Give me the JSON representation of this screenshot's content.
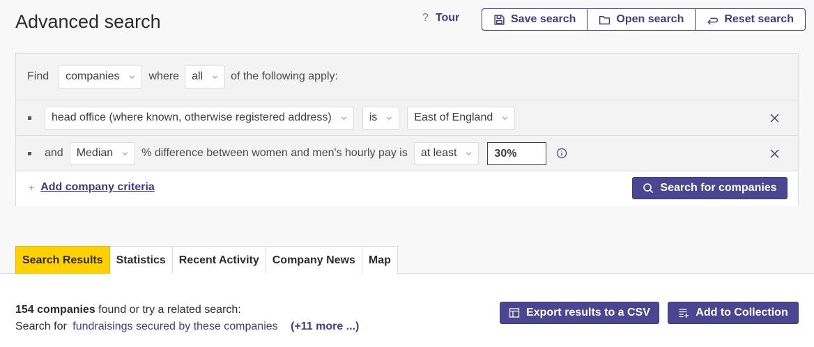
{
  "header": {
    "title": "Advanced search",
    "tour_icon": "?",
    "tour_label": "Tour",
    "save_label": "Save search",
    "open_label": "Open search",
    "reset_label": "Reset search"
  },
  "find_row": {
    "find": "Find",
    "entity": "companies",
    "where": "where",
    "quantifier": "all",
    "suffix": "of the following apply:"
  },
  "criteria": [
    {
      "field": "head office (where known, otherwise registered address)",
      "operator": "is",
      "value": "East of England"
    },
    {
      "conjunction": "and",
      "measure": "Median",
      "description": "% difference between women and men's hourly pay is",
      "operator": "at least",
      "value": "30%"
    }
  ],
  "add_criteria": {
    "plus": "+",
    "label": "Add company criteria"
  },
  "search_button": "Search for companies",
  "tabs": [
    "Search Results",
    "Statistics",
    "Recent Activity",
    "Company News",
    "Map"
  ],
  "results": {
    "count": "154 companies",
    "count_suffix": " found or try a related search:",
    "related_prefix": "Search for",
    "related_link": "fundraisings secured by these companies",
    "more": "(+11 more ...)",
    "export_label": "Export results to a CSV",
    "collection_label": "Add to Collection"
  },
  "colors": {
    "accent": "#3f3b87",
    "button_bg": "#4a4691",
    "active_tab": "#ffd100"
  }
}
